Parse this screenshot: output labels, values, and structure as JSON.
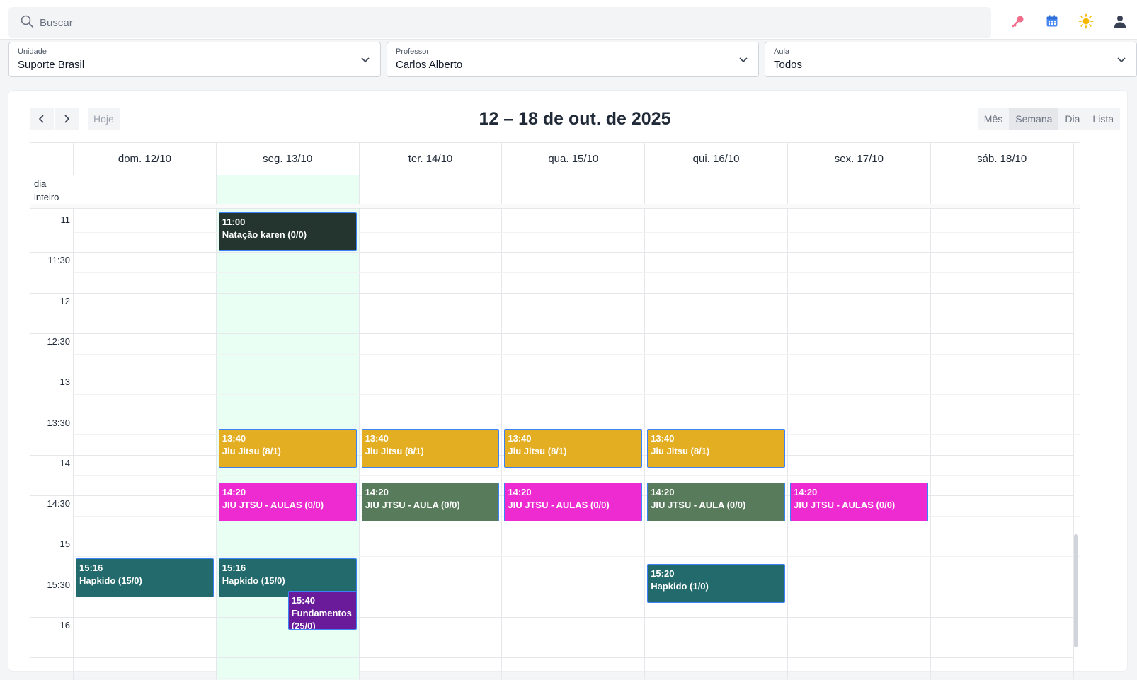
{
  "search": {
    "placeholder": "Buscar"
  },
  "filters": [
    {
      "label": "Unidade",
      "value": "Suporte Brasil"
    },
    {
      "label": "Professor",
      "value": "Carlos Alberto"
    },
    {
      "label": "Aula",
      "value": "Todos"
    }
  ],
  "toolbar": {
    "today_label": "Hoje",
    "title": "12 – 18 de out. de 2025",
    "views": [
      "Mês",
      "Semana",
      "Dia",
      "Lista"
    ],
    "active_view": "Semana"
  },
  "calendar": {
    "allday_label": "dia inteiro",
    "days": [
      "dom. 12/10",
      "seg. 13/10",
      "ter. 14/10",
      "qua. 15/10",
      "qui. 16/10",
      "sex. 17/10",
      "sáb. 18/10"
    ],
    "today_index": 1,
    "time_labels": [
      "11",
      "11:30",
      "12",
      "12:30",
      "13",
      "13:30",
      "14",
      "14:30",
      "15",
      "15:30",
      "16"
    ]
  },
  "events": [
    {
      "day": 1,
      "start": "11:00",
      "end": "11:30",
      "time": "11:00",
      "title": "Natação karen (0/0)",
      "color": "#243530"
    },
    {
      "day": 1,
      "start": "13:40",
      "end": "14:10",
      "time": "13:40",
      "title": "Jiu Jitsu (8/1)",
      "color": "#e3ae22"
    },
    {
      "day": 2,
      "start": "13:40",
      "end": "14:10",
      "time": "13:40",
      "title": "Jiu Jitsu (8/1)",
      "color": "#e3ae22"
    },
    {
      "day": 3,
      "start": "13:40",
      "end": "14:10",
      "time": "13:40",
      "title": "Jiu Jitsu (8/1)",
      "color": "#e3ae22"
    },
    {
      "day": 4,
      "start": "13:40",
      "end": "14:10",
      "time": "13:40",
      "title": "Jiu Jitsu (8/1)",
      "color": "#e3ae22"
    },
    {
      "day": 1,
      "start": "14:20",
      "end": "14:50",
      "time": "14:20",
      "title": "JIU JTSU - AULAS (0/0)",
      "color": "#ee2bd0"
    },
    {
      "day": 2,
      "start": "14:20",
      "end": "14:50",
      "time": "14:20",
      "title": "JIU JTSU - AULA (0/0)",
      "color": "#587c5b"
    },
    {
      "day": 3,
      "start": "14:20",
      "end": "14:50",
      "time": "14:20",
      "title": "JIU JTSU - AULAS (0/0)",
      "color": "#ee2bd0"
    },
    {
      "day": 4,
      "start": "14:20",
      "end": "14:50",
      "time": "14:20",
      "title": "JIU JTSU - AULA (0/0)",
      "color": "#587c5b"
    },
    {
      "day": 5,
      "start": "14:20",
      "end": "14:50",
      "time": "14:20",
      "title": "JIU JTSU - AULAS (0/0)",
      "color": "#ee2bd0"
    },
    {
      "day": 0,
      "start": "15:16",
      "end": "15:46",
      "time": "15:16",
      "title": "Hapkido (15/0)",
      "color": "#226a6b"
    },
    {
      "day": 1,
      "start": "15:16",
      "end": "15:46",
      "time": "15:16",
      "title": "Hapkido (15/0)",
      "color": "#226a6b"
    },
    {
      "day": 4,
      "start": "15:20",
      "end": "15:50",
      "time": "15:20",
      "title": "Hapkido (1/0)",
      "color": "#226a6b"
    },
    {
      "day": 1,
      "start": "15:40",
      "end": "16:10",
      "time": "15:40",
      "title": "Fundamentos (25/0)",
      "color": "#6a1b9a",
      "overlap": true
    }
  ],
  "icons": {
    "search": "search-icon",
    "key": "key-icon",
    "calendar": "calendar-icon",
    "theme": "sun-icon",
    "user": "user-icon"
  }
}
